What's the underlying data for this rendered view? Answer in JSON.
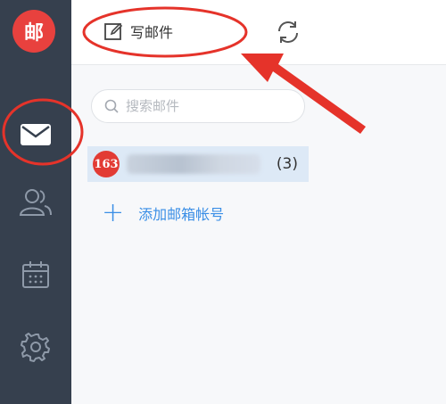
{
  "app": {
    "logo_char": "邮"
  },
  "toolbar": {
    "compose_label": "写邮件"
  },
  "search": {
    "placeholder": "搜索邮件"
  },
  "accounts": [
    {
      "badge": "163",
      "unread": "(3)"
    }
  ],
  "add_account": {
    "plus": "+",
    "label": "添加邮箱帐号"
  },
  "sidebar": {
    "items": [
      {
        "icon": "mail-icon"
      },
      {
        "icon": "contacts-icon"
      },
      {
        "icon": "calendar-icon"
      },
      {
        "icon": "settings-icon"
      }
    ]
  },
  "colors": {
    "sidebar": "#36404e",
    "accent": "#3a8ee6",
    "brand": "#e8413e",
    "annotation": "#e5332a"
  }
}
